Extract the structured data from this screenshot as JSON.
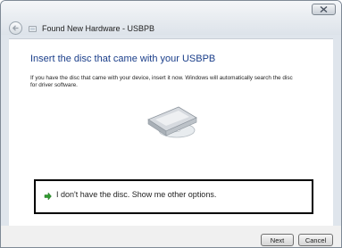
{
  "window": {
    "title": "Found New Hardware - USBPB"
  },
  "main": {
    "heading": "Insert the disc that came with your USBPB",
    "description": "If you have the disc that came with your device, insert it now.  Windows will automatically search the disc for driver software.",
    "illustration_icon": "disc-drive-icon"
  },
  "option": {
    "label": "I don't have the disc.  Show me other options.",
    "icon": "green-arrow-icon"
  },
  "buttons": {
    "next": "Next",
    "cancel": "Cancel"
  },
  "colors": {
    "heading": "#1a3e8a",
    "arrow": "#2f9b2f",
    "option_border": "#000000"
  }
}
